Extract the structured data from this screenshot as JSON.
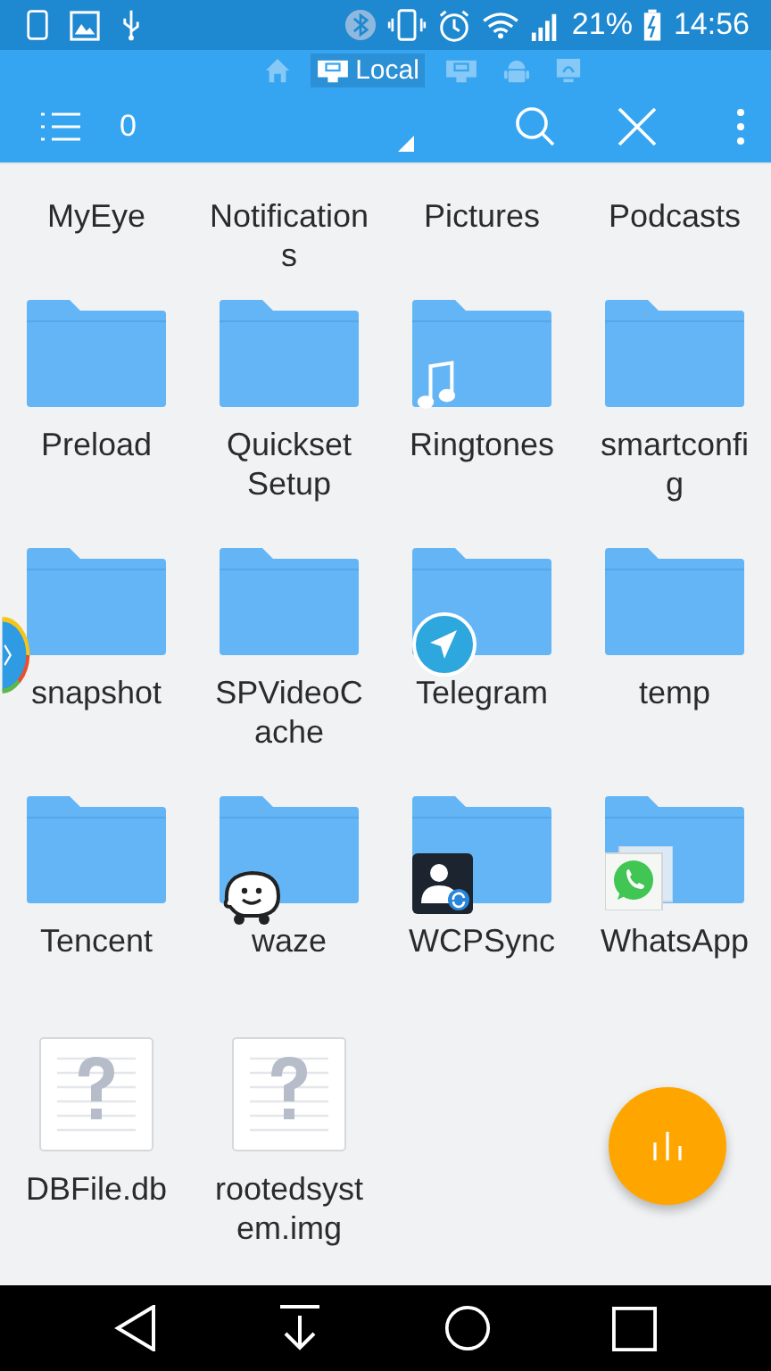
{
  "status_bar": {
    "battery_percent": "21%",
    "time": "14:56"
  },
  "path_bar": [
    {
      "kind": "home",
      "selected": false
    },
    {
      "kind": "storage",
      "label": "Local",
      "selected": true
    },
    {
      "kind": "storage",
      "selected": false
    },
    {
      "kind": "android",
      "selected": false
    },
    {
      "kind": "network",
      "selected": false
    }
  ],
  "toolbar": {
    "selected_count": "0"
  },
  "scrolled_row": [
    "MyEye",
    "Notifications",
    "Pictures",
    "Podcasts"
  ],
  "items": [
    {
      "name": "Preload",
      "kind": "folder"
    },
    {
      "name": "Quickset Setup",
      "kind": "folder"
    },
    {
      "name": "Ringtones",
      "kind": "folder-music"
    },
    {
      "name": "smartconfig",
      "kind": "folder"
    },
    {
      "name": "snapshot",
      "kind": "folder"
    },
    {
      "name": "SPVideoCache",
      "kind": "folder"
    },
    {
      "name": "Telegram",
      "kind": "folder-telegram"
    },
    {
      "name": "temp",
      "kind": "folder"
    },
    {
      "name": "Tencent",
      "kind": "folder"
    },
    {
      "name": "waze",
      "kind": "folder-waze"
    },
    {
      "name": "WCPSync",
      "kind": "folder-contacts"
    },
    {
      "name": "WhatsApp",
      "kind": "folder-whatsapp"
    },
    {
      "name": "DBFile.db",
      "kind": "file"
    },
    {
      "name": "rootedsystem.img",
      "kind": "file"
    }
  ]
}
